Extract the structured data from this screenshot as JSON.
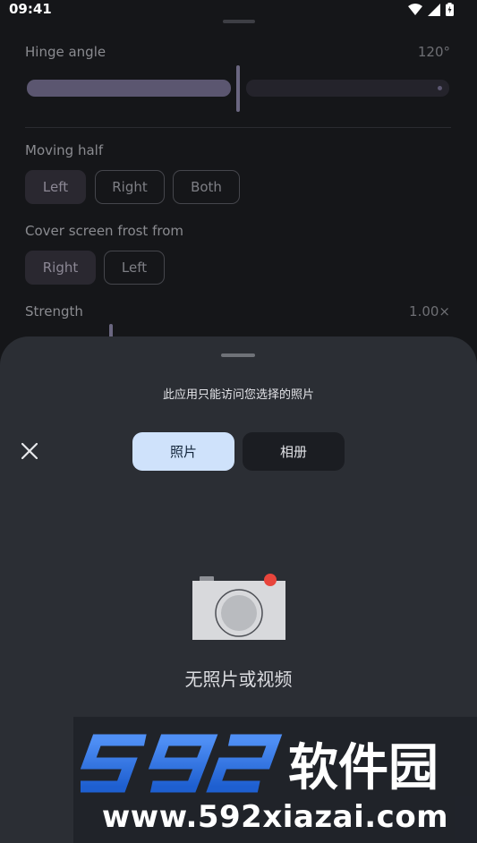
{
  "status_bar": {
    "time": "09:41",
    "icons": [
      "wifi-icon",
      "signal-icon",
      "battery-icon"
    ]
  },
  "settings": {
    "hinge_angle": {
      "label": "Hinge angle",
      "value": "120°",
      "fill_fraction": 0.5
    },
    "moving_half": {
      "label": "Moving half",
      "options": [
        "Left",
        "Right",
        "Both"
      ],
      "selected": "Left"
    },
    "cover_frost": {
      "label": "Cover screen frost from",
      "options": [
        "Right",
        "Left"
      ],
      "selected": "Right"
    },
    "strength": {
      "label": "Strength",
      "value": "1.00×"
    }
  },
  "picker": {
    "title": "此应用只能访问您选择的照片",
    "tabs": [
      "照片",
      "相册"
    ],
    "active_tab": "照片",
    "empty_message": "无照片或视频",
    "close_icon": "close-icon",
    "empty_icon": "camera-icon"
  },
  "watermark": {
    "logo_digits": "592",
    "logo_text": "软件园",
    "url": "www.592xiazai.com"
  },
  "colors": {
    "sheet_bg": "#2b2e34",
    "active_tab_bg": "#cfe2fb",
    "inactive_tab_bg": "#1b1d22",
    "camera_dot": "#e8453c",
    "logo_blue": "#2f6fe0"
  }
}
